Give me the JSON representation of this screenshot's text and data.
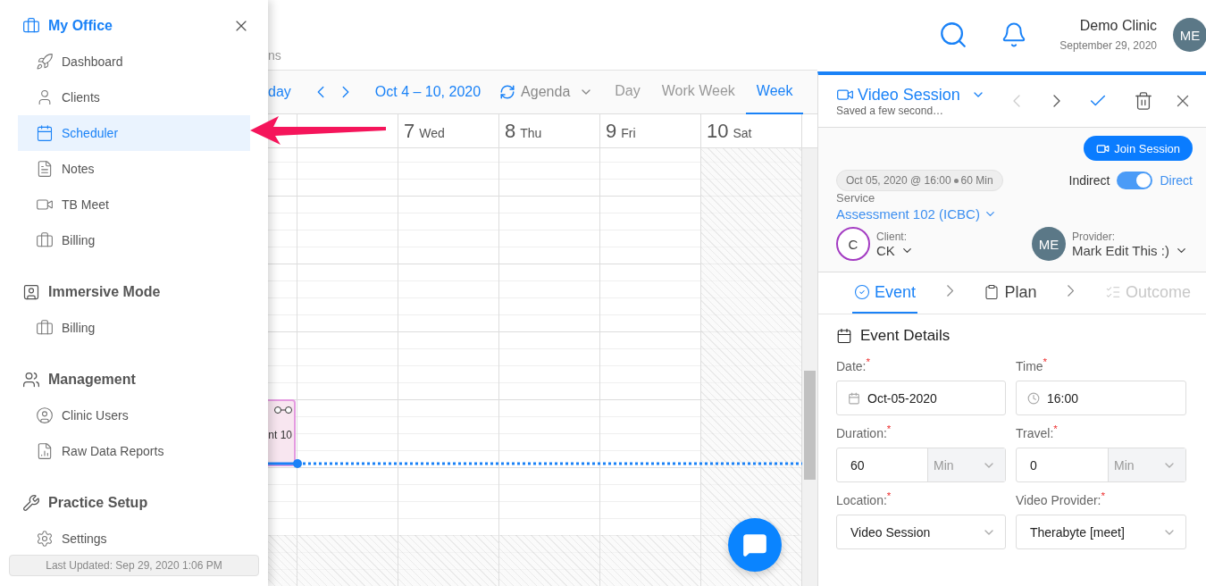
{
  "sidebar": {
    "sections": [
      {
        "title": "My Office",
        "active": true,
        "items": [
          {
            "label": "Dashboard",
            "selected": false
          },
          {
            "label": "Clients",
            "selected": false
          },
          {
            "label": "Scheduler",
            "selected": true
          },
          {
            "label": "Notes",
            "selected": false
          },
          {
            "label": "TB Meet",
            "selected": false
          },
          {
            "label": "Billing",
            "selected": false
          }
        ]
      },
      {
        "title": "Immersive Mode",
        "active": false,
        "items": [
          {
            "label": "Billing",
            "selected": false
          }
        ]
      },
      {
        "title": "Management",
        "active": false,
        "items": [
          {
            "label": "Clinic Users",
            "selected": false
          },
          {
            "label": "Raw Data Reports",
            "selected": false
          }
        ]
      },
      {
        "title": "Practice Setup",
        "active": false,
        "items": [
          {
            "label": "Settings",
            "selected": false
          }
        ]
      }
    ],
    "footer": "Last Updated: Sep 29, 2020 1:06 PM"
  },
  "header": {
    "breadcrumb": "ns",
    "clinic": "Demo Clinic",
    "date": "September 29, 2020",
    "avatar": "ME"
  },
  "calendar": {
    "today": "day",
    "range": "Oct 4 – 10, 2020",
    "view_menu": "Agenda",
    "views": [
      {
        "label": "Day",
        "selected": false
      },
      {
        "label": "Work Week",
        "selected": false
      },
      {
        "label": "Week",
        "selected": true
      }
    ],
    "days": [
      {
        "number": "7",
        "name": "Wed",
        "off": false
      },
      {
        "number": "8",
        "name": "Thu",
        "off": false
      },
      {
        "number": "9",
        "name": "Fri",
        "off": false
      },
      {
        "number": "10",
        "name": "Sat",
        "off": true
      }
    ],
    "event": {
      "label": "nt 10"
    }
  },
  "panel": {
    "title": "Video Session",
    "subtitle": "Saved a few second…",
    "join": "Join Session",
    "chip": {
      "date": "Oct 05, 2020 @ 16:00",
      "duration": "60 Min"
    },
    "toggle": {
      "left": "Indirect",
      "right": "Direct",
      "on": true
    },
    "service_label": "Service",
    "service": "Assessment 102 (ICBC)",
    "client": {
      "label": "Client:",
      "initial": "C",
      "name": "CK"
    },
    "provider": {
      "label": "Provider:",
      "initials": "ME",
      "name": "Mark Edit This :)"
    },
    "steps": [
      {
        "label": "Event",
        "selected": true,
        "disabled": false
      },
      {
        "label": "Plan",
        "selected": false,
        "disabled": false
      },
      {
        "label": "Outcome",
        "selected": false,
        "disabled": true
      }
    ],
    "details": {
      "title": "Event Details",
      "fields": [
        {
          "kind": "date",
          "label": "Date:",
          "mark": "*",
          "value": "Oct-05-2020"
        },
        {
          "kind": "time",
          "label": "Time",
          "mark": "*",
          "value": "16:00"
        },
        {
          "kind": "amount",
          "label": "Duration:",
          "mark": "*",
          "value": "60",
          "unit": "Min"
        },
        {
          "kind": "amount",
          "label": "Travel:",
          "mark": "*",
          "value": "0",
          "unit": "Min"
        },
        {
          "kind": "select",
          "label": "Location:",
          "mark": "*",
          "value": "Video Session"
        },
        {
          "kind": "select",
          "label": "Video Provider:",
          "mark": "*",
          "value": "Therabyte [meet]"
        }
      ]
    }
  }
}
